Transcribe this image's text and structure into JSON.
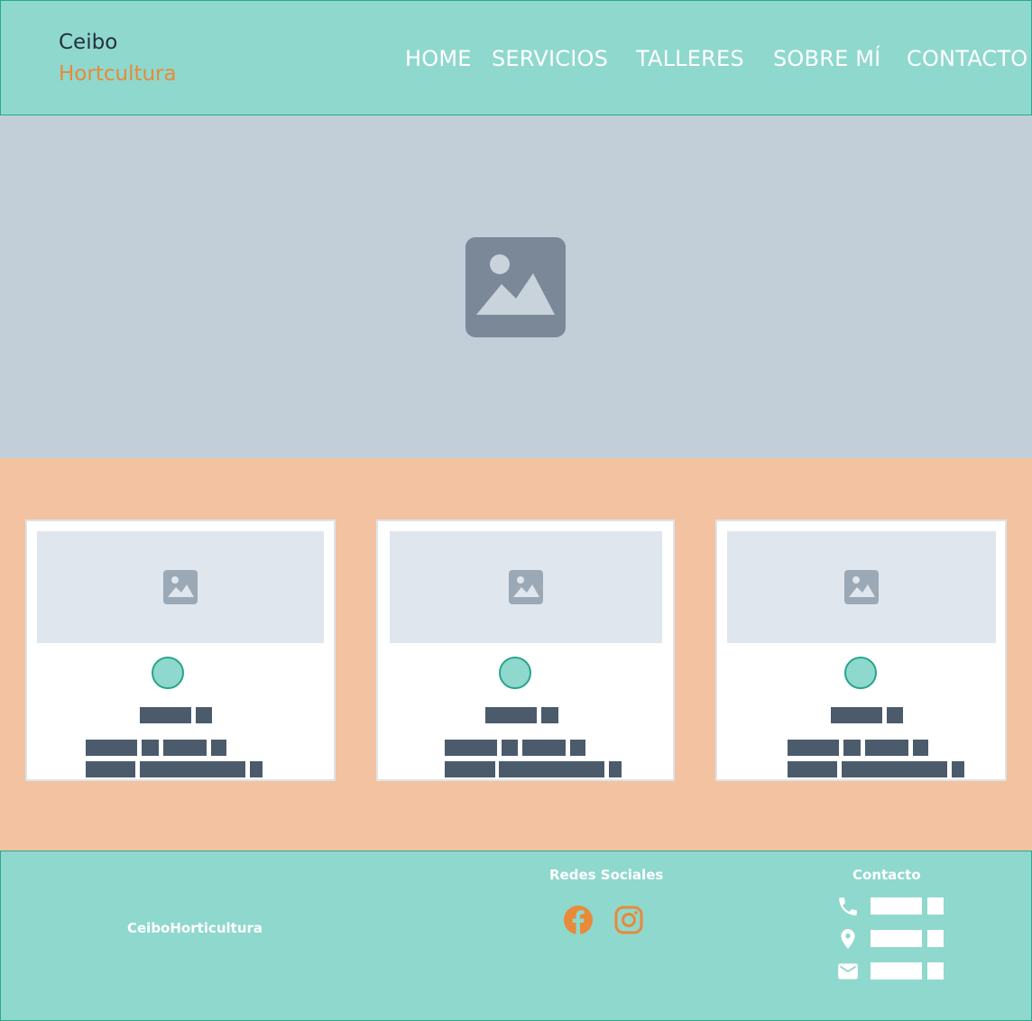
{
  "header": {
    "logo_line1": "Ceibo",
    "logo_line2": "Hortcultura",
    "nav": [
      "HOME",
      "SERVICIOS",
      "TALLERES",
      "SOBRE MÍ",
      "CONTACTO"
    ]
  },
  "hero": {
    "image_icon": "image-placeholder-icon"
  },
  "cards": {
    "items": [
      {
        "image_icon": "image-placeholder-icon"
      },
      {
        "image_icon": "image-placeholder-icon"
      },
      {
        "image_icon": "image-placeholder-icon"
      }
    ]
  },
  "footer": {
    "brand": "CeiboHorticultura",
    "social_heading": "Redes Sociales",
    "social_icons": [
      "facebook-icon",
      "instagram-icon"
    ],
    "contact_heading": "Contacto",
    "contact_icons": [
      "phone-icon",
      "location-icon",
      "mail-icon"
    ]
  },
  "colors": {
    "teal": "#8fd8cd",
    "orange": "#e78a3a",
    "peach": "#f3c2a0",
    "slate": "#4b5b6c"
  }
}
